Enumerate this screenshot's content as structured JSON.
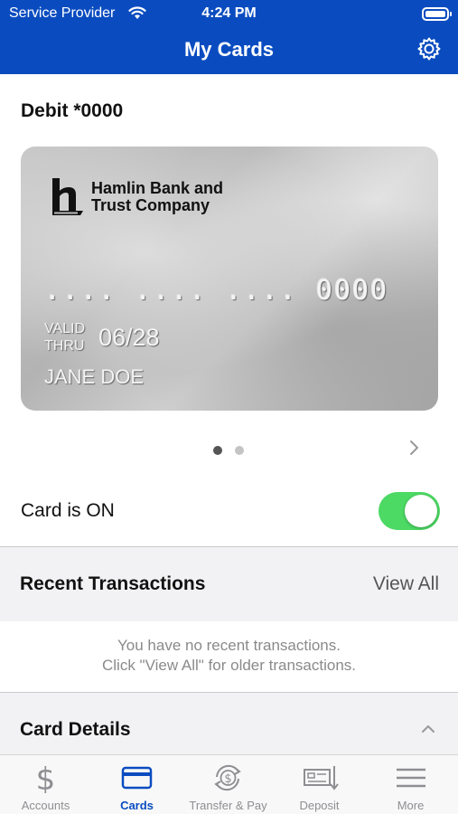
{
  "status_bar": {
    "carrier": "Service Provider",
    "time": "4:24 PM"
  },
  "header": {
    "title": "My Cards",
    "settings_icon": "gear-icon"
  },
  "card": {
    "label": "Debit *0000",
    "bank_name_line1": "Hamlin Bank and",
    "bank_name_line2": "Trust Company",
    "number": ".... .... .... 0000",
    "valid_line1": "VALID",
    "valid_line2": "THRU",
    "expiry": "06/28",
    "holder": "JANE DOE"
  },
  "pager": {
    "count": 2,
    "active": 0
  },
  "card_toggle": {
    "label": "Card is ON",
    "on": true
  },
  "recent": {
    "title": "Recent Transactions",
    "view_all": "View All",
    "empty_line1": "You have no recent transactions.",
    "empty_line2": "Click \"View All\" for older transactions."
  },
  "details": {
    "title": "Card Details"
  },
  "tabs": [
    {
      "label": "Accounts",
      "icon": "dollar-icon",
      "active": false
    },
    {
      "label": "Cards",
      "icon": "card-icon",
      "active": true
    },
    {
      "label": "Transfer & Pay",
      "icon": "transfer-icon",
      "active": false
    },
    {
      "label": "Deposit",
      "icon": "deposit-check-icon",
      "active": false
    },
    {
      "label": "More",
      "icon": "menu-icon",
      "active": false
    }
  ],
  "colors": {
    "brand": "#0a4cc0",
    "toggle_on": "#4cd964",
    "inactive_tab": "#8e8e93"
  }
}
